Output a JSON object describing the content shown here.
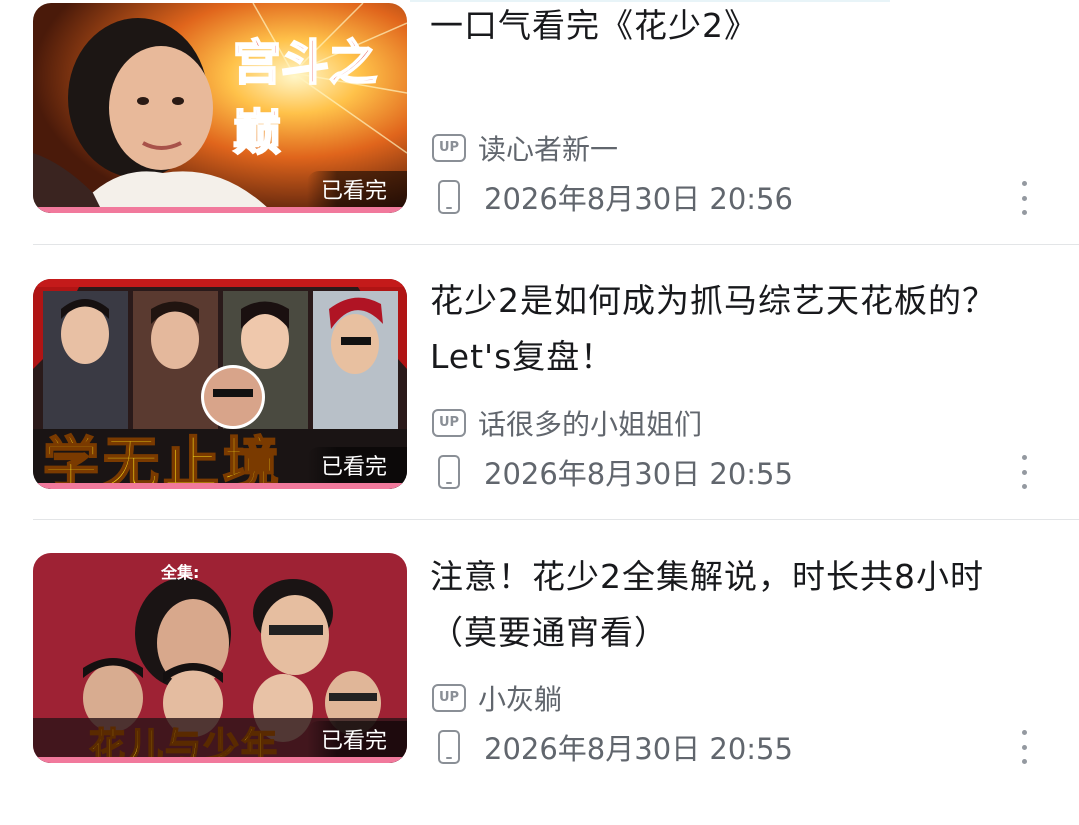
{
  "colors": {
    "accent_pink": "#f1799c",
    "title_text": "#18191c",
    "meta_text": "#61666d",
    "divider": "#e3e5e7"
  },
  "videos": [
    {
      "title": "一口气看完《花少2》",
      "thumb_text": "宫斗之巅",
      "watched_label": "已看完",
      "uploader": "读心者新一",
      "up_badge": "UP",
      "datetime": "2026年8月30日 20:56",
      "uploader_icon": "up-badge-icon",
      "date_icon": "phone-icon",
      "more_icon": "more-vertical-icon"
    },
    {
      "title": "花少2是如何成为抓马综艺天花板的？Let's复盘！",
      "thumb_text": "学无止境",
      "watched_label": "已看完",
      "uploader": "话很多的小姐姐们",
      "up_badge": "UP",
      "datetime": "2026年8月30日 20:55",
      "uploader_icon": "up-badge-icon",
      "date_icon": "phone-icon",
      "more_icon": "more-vertical-icon"
    },
    {
      "title": "注意！花少2全集解说，时长共8小时（莫要通宵看）",
      "thumb_text": "花儿与少年",
      "thumb_top_text": "全集:",
      "watched_label": "已看完",
      "uploader": "小灰躺",
      "up_badge": "UP",
      "datetime": "2026年8月30日 20:55",
      "uploader_icon": "up-badge-icon",
      "date_icon": "phone-icon",
      "more_icon": "more-vertical-icon"
    }
  ]
}
